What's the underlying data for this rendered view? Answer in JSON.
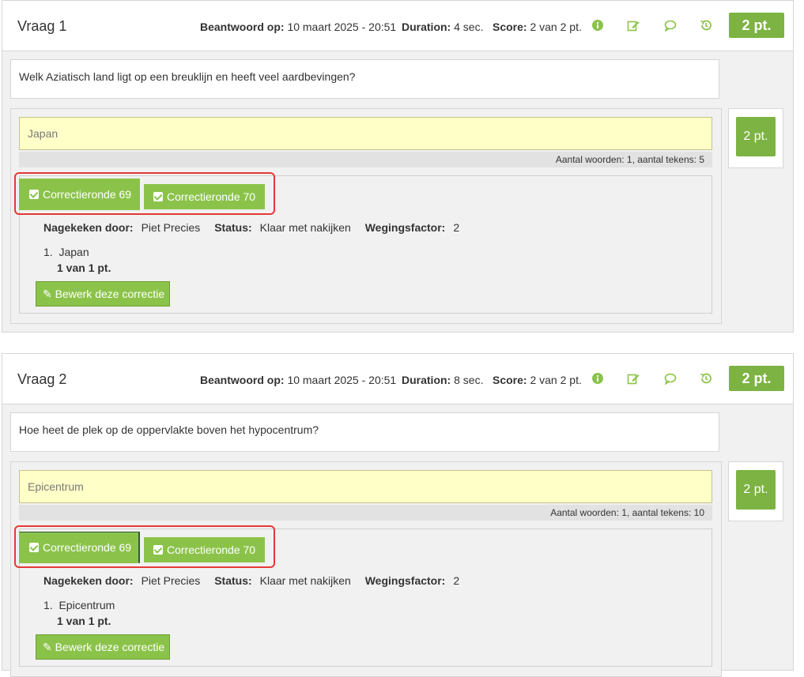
{
  "colors": {
    "accent": "#8bc34a",
    "points": "#7cb342",
    "highlight": "#e53935",
    "answer_bg": "#ffffc8"
  },
  "labels": {
    "answered_on": "Beantwoord op:",
    "duration": "Duration:",
    "score": "Score:",
    "word_count_prefix": "Aantal woorden:",
    "checked_by": "Nagekeken door:",
    "status": "Status:",
    "weight": "Wegingsfactor:",
    "edit_correction": "Bewerk deze correctie"
  },
  "icons": [
    "info-icon",
    "edit-icon",
    "comment-icon",
    "history-icon",
    "checkbox-icon",
    "pencil-icon"
  ],
  "questions": [
    {
      "title": "Vraag 1",
      "answered_on": "10 maart 2025 - 20:51",
      "duration": "4 sec.",
      "score": "2 van 2 pt.",
      "points": "2 pt.",
      "text": "Welk Aziatisch land ligt op een breuklijn en heeft veel aardbevingen?",
      "answer": "Japan",
      "count": "Aantal woorden: 1, aantal tekens: 5",
      "side_points": "2 pt.",
      "tabs": [
        "Correctieronde 69",
        "Correctieronde 70"
      ],
      "checked_by": "Piet Precies",
      "status": "Klaar met nakijken",
      "weight": "2",
      "item": "Japan",
      "item_score": "1 van 1 pt."
    },
    {
      "title": "Vraag 2",
      "answered_on": "10 maart 2025 - 20:51",
      "duration": "8 sec.",
      "score": "2 van 2 pt.",
      "points": "2 pt.",
      "text": "Hoe heet de plek op de oppervlakte boven het hypocentrum?",
      "answer": "Epicentrum",
      "count": "Aantal woorden: 1, aantal tekens: 10",
      "side_points": "2 pt.",
      "tabs": [
        "Correctieronde 69",
        "Correctieronde 70"
      ],
      "checked_by": "Piet Precies",
      "status": "Klaar met nakijken",
      "weight": "2",
      "item": "Epicentrum",
      "item_score": "1 van 1 pt."
    }
  ]
}
